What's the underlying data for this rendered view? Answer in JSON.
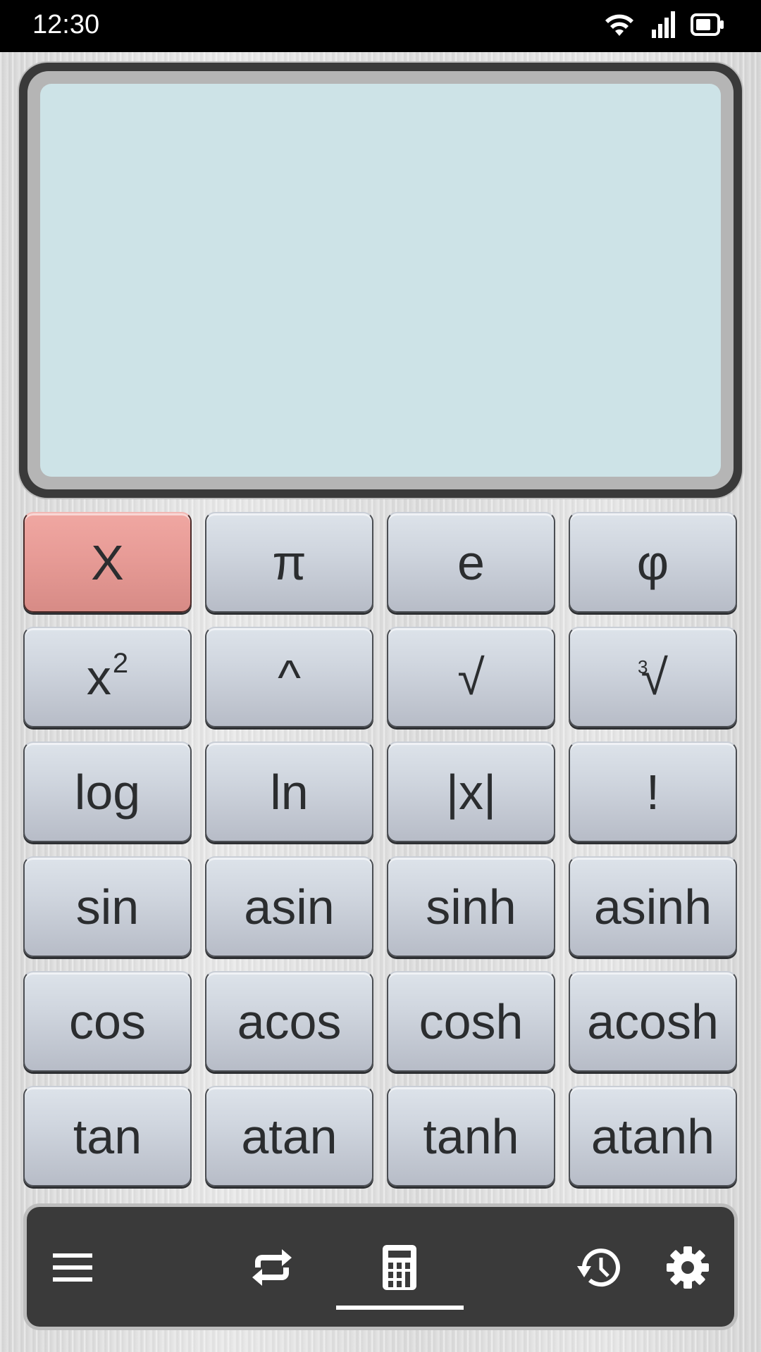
{
  "status_bar": {
    "time": "12:30",
    "icons": [
      "wifi-icon",
      "cellular-signal-icon",
      "battery-icon"
    ]
  },
  "display": {
    "expression": "",
    "result": ""
  },
  "keypad": {
    "rows": [
      [
        {
          "id": "clear",
          "label": "X",
          "color": "#e99d98"
        },
        {
          "id": "pi",
          "label": "π"
        },
        {
          "id": "e",
          "label": "e"
        },
        {
          "id": "phi",
          "label": "φ"
        }
      ],
      [
        {
          "id": "square",
          "label": "x",
          "sup": "2"
        },
        {
          "id": "power",
          "label": "^"
        },
        {
          "id": "sqrt",
          "label": "√"
        },
        {
          "id": "cbrt",
          "label": "√",
          "index": "3"
        }
      ],
      [
        {
          "id": "log",
          "label": "log"
        },
        {
          "id": "ln",
          "label": "ln"
        },
        {
          "id": "abs",
          "label": "|x|"
        },
        {
          "id": "factorial",
          "label": "!"
        }
      ],
      [
        {
          "id": "sin",
          "label": "sin"
        },
        {
          "id": "asin",
          "label": "asin"
        },
        {
          "id": "sinh",
          "label": "sinh"
        },
        {
          "id": "asinh",
          "label": "asinh"
        }
      ],
      [
        {
          "id": "cos",
          "label": "cos"
        },
        {
          "id": "acos",
          "label": "acos"
        },
        {
          "id": "cosh",
          "label": "cosh"
        },
        {
          "id": "acosh",
          "label": "acosh"
        }
      ],
      [
        {
          "id": "tan",
          "label": "tan"
        },
        {
          "id": "atan",
          "label": "atan"
        },
        {
          "id": "tanh",
          "label": "tanh"
        },
        {
          "id": "atanh",
          "label": "atanh"
        }
      ]
    ]
  },
  "nav_bar": {
    "items": [
      {
        "id": "menu",
        "icon": "menu-icon"
      },
      {
        "id": "convert",
        "icon": "swap-arrows-icon"
      },
      {
        "id": "calculator",
        "icon": "calculator-icon",
        "active": true
      },
      {
        "id": "history",
        "icon": "history-icon"
      },
      {
        "id": "settings",
        "icon": "gear-icon"
      }
    ]
  },
  "colors": {
    "display_bg": "#cde3e7",
    "clear_key": "#e99d98",
    "key_bg": "#cfd5de",
    "nav_bg": "#3a3a3a",
    "text": "#2b2d2f"
  }
}
